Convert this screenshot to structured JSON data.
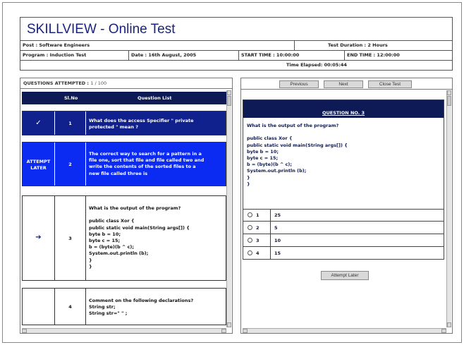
{
  "header": {
    "title": "SKILLVIEW - Online Test",
    "post": "Post : Software Engineers",
    "test_duration": "Test Duration : 2 Hours",
    "program": "Program : Induction Test",
    "date": "Date : 16th August, 2005",
    "start_time": "START TIME : 10:00:00",
    "end_time": "END TIME : 12:00:00",
    "time_elapsed": "Time Elapsed: 00:05:44"
  },
  "left": {
    "attempted_label": "QUESTIONS ATTEMPTED : ",
    "attempted_value": "1 / 100",
    "columns": {
      "slno": "Sl.No",
      "question_list": "Question List"
    },
    "rows": [
      {
        "status": "✓",
        "num": "1",
        "text": "What does the access Specifier \" private\nprotected \" mean ?"
      },
      {
        "status": "ATTEMPT\nLATER",
        "num": "2",
        "text": "The correct way to search for a pattern in a\nfile one, sort that file and file called two and\nwrite the contents of the sorted files to a\nnew file called three is"
      },
      {
        "status": "➔",
        "num": "3",
        "text": "What is the output of the program?\n\npublic class Xor {\npublic static void main(String args[]) {\nbyte b = 10;\nbyte c = 15;\nb = (byte)(b ^ c);\nSystem.out.println (b);\n}\n}"
      },
      {
        "status": "",
        "num": "4",
        "text": "Comment on the following declarations?\nString str;\nString str=\" \" ;"
      }
    ]
  },
  "right": {
    "buttons": {
      "previous": "Previous",
      "next": "Next",
      "close": "Close Test"
    },
    "question_no": "QUESTION NO. 3",
    "question_text": "What is the output of the program?\n\npublic class Xor {\npublic static void main(String args[]) {\nbyte b = 10;\nbyte c = 15;\nb = (byte)(b ^ c);\nSystem.out.println (b);\n}\n}",
    "options": [
      {
        "num": "1",
        "value": "25"
      },
      {
        "num": "2",
        "value": "5"
      },
      {
        "num": "3",
        "value": "10"
      },
      {
        "num": "4",
        "value": "15"
      }
    ],
    "attempt_later": "Attempt Later"
  },
  "colors": {
    "header_navy": "#0d1a55",
    "answered_row": "#10208c",
    "attempt_later_row": "#0c2bf2",
    "title_text": "#1a237e"
  }
}
